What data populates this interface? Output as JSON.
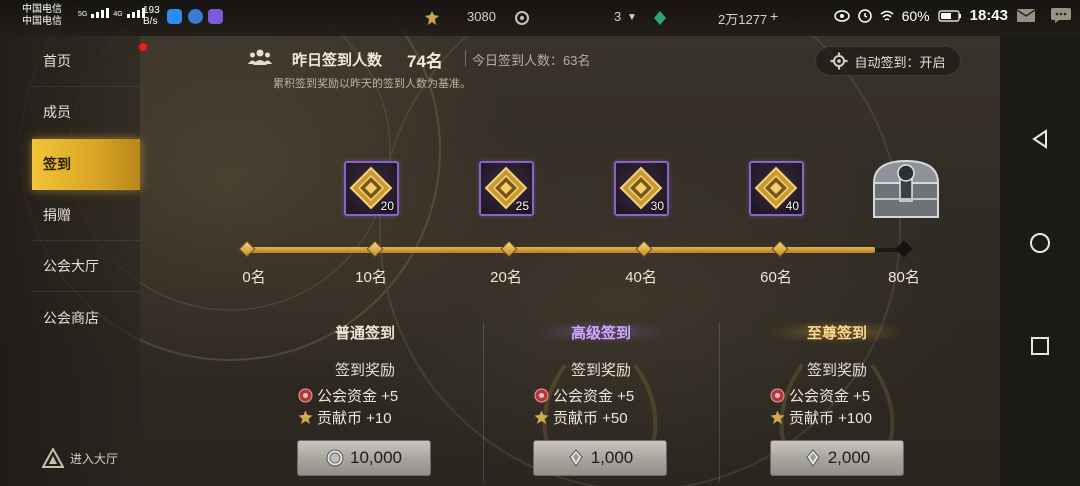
{
  "status_bar": {
    "carrier_1": "中国电信",
    "carrier_2": "中国电信",
    "net_type_1": "5G",
    "net_type_2": "4G",
    "net_speed_value": "193",
    "net_speed_unit": "B/s",
    "battery": "60%",
    "time": "18:43"
  },
  "resources": {
    "res1": "3080",
    "res2": "3",
    "res3": "2万1277"
  },
  "sidebar": {
    "items": [
      {
        "label": "首页"
      },
      {
        "label": "成员"
      },
      {
        "label": "签到"
      },
      {
        "label": "捐赠"
      },
      {
        "label": "公会大厅"
      },
      {
        "label": "公会商店"
      }
    ],
    "enter_hall": "进入大厅"
  },
  "header": {
    "yesterday_label": "昨日签到人数",
    "yesterday_count": "74名",
    "today_label": "今日签到人数：63名",
    "note": "累积签到奖励以昨天的签到人数为基准。",
    "auto_checkin": "自动签到：开启"
  },
  "progress": {
    "rewards": [
      {
        "qty": "20"
      },
      {
        "qty": "25"
      },
      {
        "qty": "30"
      },
      {
        "qty": "40"
      }
    ],
    "ticks": [
      "0名",
      "10名",
      "20名",
      "40名",
      "60名",
      "80名"
    ]
  },
  "tiers": [
    {
      "name": "普通签到",
      "subtitle": "签到奖励",
      "reward1": "公会资金 +5",
      "reward2": "贡献币 +10",
      "price": "10,000"
    },
    {
      "name": "高级签到",
      "subtitle": "签到奖励",
      "reward1": "公会资金 +5",
      "reward2": "贡献币 +50",
      "price": "1,000"
    },
    {
      "name": "至尊签到",
      "subtitle": "签到奖励",
      "reward1": "公会资金 +5",
      "reward2": "贡献币 +100",
      "price": "2,000"
    }
  ],
  "colors": {
    "accent_gold": "#f2c437",
    "advanced_purple": "#d2a9ff",
    "supreme_gold": "#ffd98a",
    "reward_border": "#8a63c9"
  }
}
